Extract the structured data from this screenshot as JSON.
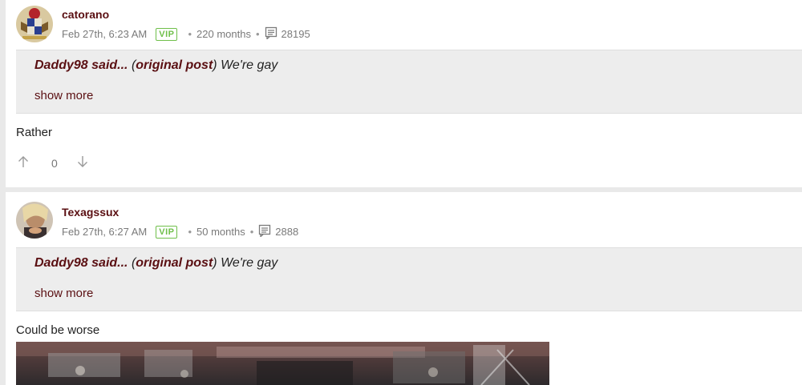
{
  "posts": [
    {
      "username": "catorano",
      "timestamp": "Feb 27th, 6:23 AM",
      "badge": "VIP",
      "tenure": "220 months",
      "post_count": "28195",
      "quote": {
        "author": "Daddy98 said...",
        "ref_open": " (",
        "ref": "original post",
        "ref_close": ") ",
        "text": "We're gay",
        "show_more": "show more"
      },
      "body": "Rather",
      "votes": {
        "up_icon": "arrow-up-icon",
        "count": "0",
        "down_icon": "arrow-down-icon"
      }
    },
    {
      "username": "Texagssux",
      "timestamp": "Feb 27th, 6:27 AM",
      "badge": "VIP",
      "tenure": "50 months",
      "post_count": "2888",
      "quote": {
        "author": "Daddy98 said...",
        "ref_open": " (",
        "ref": "original post",
        "ref_close": ") ",
        "text": "We're gay",
        "show_more": "show more"
      },
      "body": "Could be worse"
    }
  ],
  "colors": {
    "maroon": "#5a0f12",
    "vip_green": "#6fbf4a",
    "quote_bg": "#ededed"
  }
}
